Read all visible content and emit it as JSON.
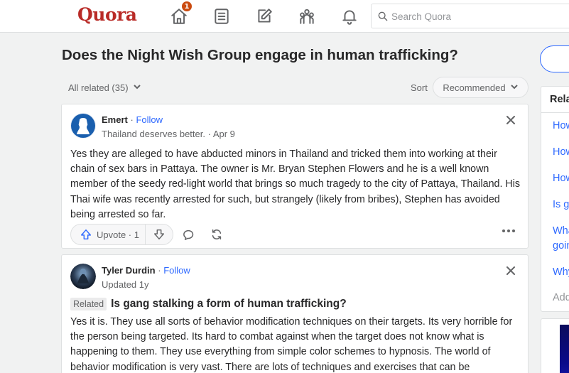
{
  "header": {
    "logo": "Quora",
    "notification_count": "1",
    "search_placeholder": "Search Quora",
    "nav_icons": [
      "home-icon",
      "following-icon",
      "answer-icon",
      "spaces-icon",
      "notifications-icon"
    ]
  },
  "question": {
    "title": "Does the Night Wish Group engage in human trafficking?",
    "all_related": "All related (35)",
    "sort_label": "Sort",
    "sort_value": "Recommended"
  },
  "answers": [
    {
      "author": "Emert",
      "follow": "Follow",
      "credential": "Thailand deserves better. · Apr 9",
      "text": "Yes they are alleged to have abducted minors in Thailand and tricked them into working at their chain of sex bars in Pattaya. The owner is Mr. Bryan Stephen Flowers and he is a well known member of the seedy red-light world that brings so much tragedy to the city of Pattaya, Thailand. His Thai wife was recently arrested for such, but strangely (likely from bribes), Stephen has avoided being arrested so far.",
      "upvote_label": "Upvote · 1"
    },
    {
      "author": "Tyler Durdin",
      "follow": "Follow",
      "credential": "Updated 1y",
      "related_tag": "Related",
      "related_question": "Is gang stalking a form of human trafficking?",
      "text": "Yes it is. They use all sorts of behavior modification techniques on their targets. Its very horrible for the person being targeted. Its hard to combat against when the target does not know what is happening to them. They use everything from simple color schemes to hypnosis. The world of behavior modification is very vast. There are lots of techniques and exercises that can be"
    }
  ],
  "sidebar": {
    "title": "Rela",
    "links": [
      "How",
      "How",
      "How",
      "Is g",
      "Wha",
      "goin",
      "Why"
    ],
    "add": "Add"
  },
  "colors": {
    "brand": "#b92b27",
    "link": "#2e69ff",
    "badge": "#cb4b10"
  }
}
